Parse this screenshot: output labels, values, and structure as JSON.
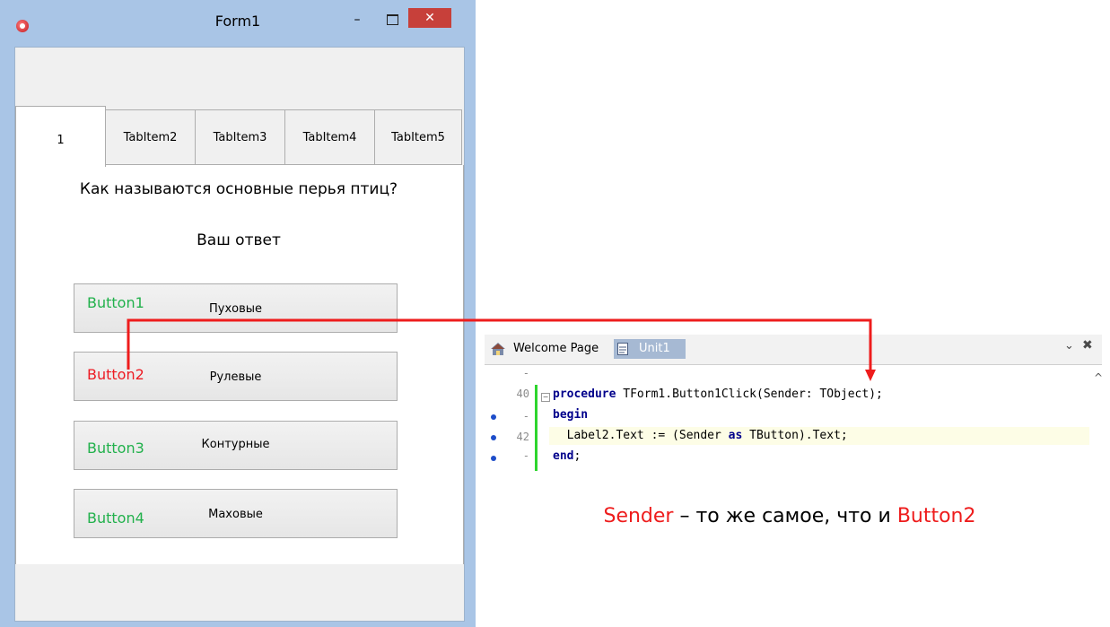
{
  "window": {
    "title": "Form1",
    "minimize_glyph": "–",
    "close_glyph": "✕"
  },
  "tabs": [
    {
      "label": "1"
    },
    {
      "label": "TabItem2"
    },
    {
      "label": "TabItem3"
    },
    {
      "label": "TabItem4"
    },
    {
      "label": "TabItem5"
    }
  ],
  "question": "Как называются основные перья птиц?",
  "answer_label": "Ваш ответ",
  "buttons": [
    {
      "name": "Button1",
      "text": "Пуховые",
      "name_color": "#22b14c"
    },
    {
      "name": "Button2",
      "text": "Рулевые",
      "name_color": "#ed1c24"
    },
    {
      "name": "Button3",
      "text": "Контурные",
      "name_color": "#22b14c"
    },
    {
      "name": "Button4",
      "text": "Маховые",
      "name_color": "#22b14c"
    }
  ],
  "ide": {
    "tabs": [
      "Welcome Page",
      "Unit1"
    ],
    "pin_glyph": "⌄",
    "close_glyph": "✖",
    "line_numbers": [
      "-",
      "40",
      "-",
      "42",
      "-"
    ],
    "code": {
      "line1_kw": "procedure",
      "line1_rest": " TForm1.Button1Click(Sender: TObject);",
      "line2_kw": "begin",
      "line3_a": "  Label2.Text := (Sender ",
      "line3_kw": "as",
      "line3_b": " TButton).Text;",
      "line4_kw": "end",
      "line4_rest": ";"
    }
  },
  "caption": {
    "sender": "Sender",
    "middle": " – то же самое, что и ",
    "button": "Button2"
  },
  "colors": {
    "accent_red": "#ee1c1c",
    "accent_green": "#22b14c",
    "change_bar": "#2ed52e"
  }
}
